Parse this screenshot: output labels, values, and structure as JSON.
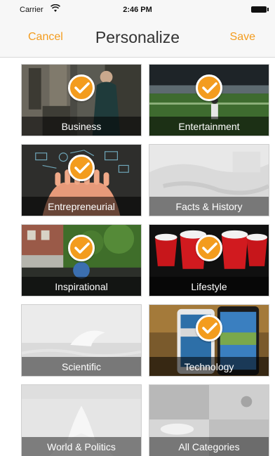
{
  "status_bar": {
    "carrier": "Carrier",
    "time": "2:46 PM"
  },
  "nav": {
    "cancel": "Cancel",
    "title": "Personalize",
    "save": "Save"
  },
  "categories": [
    {
      "label": "Business",
      "selected": true
    },
    {
      "label": "Entertainment",
      "selected": true
    },
    {
      "label": "Entrepreneurial",
      "selected": true
    },
    {
      "label": "Facts & History",
      "selected": false
    },
    {
      "label": "Inspirational",
      "selected": true
    },
    {
      "label": "Lifestyle",
      "selected": true
    },
    {
      "label": "Scientific",
      "selected": false
    },
    {
      "label": "Technology",
      "selected": true
    },
    {
      "label": "World & Politics",
      "selected": false
    },
    {
      "label": "All Categories",
      "selected": false
    }
  ],
  "colors": {
    "accent": "#f39c1e",
    "nav_background": "#f7f7f7"
  }
}
